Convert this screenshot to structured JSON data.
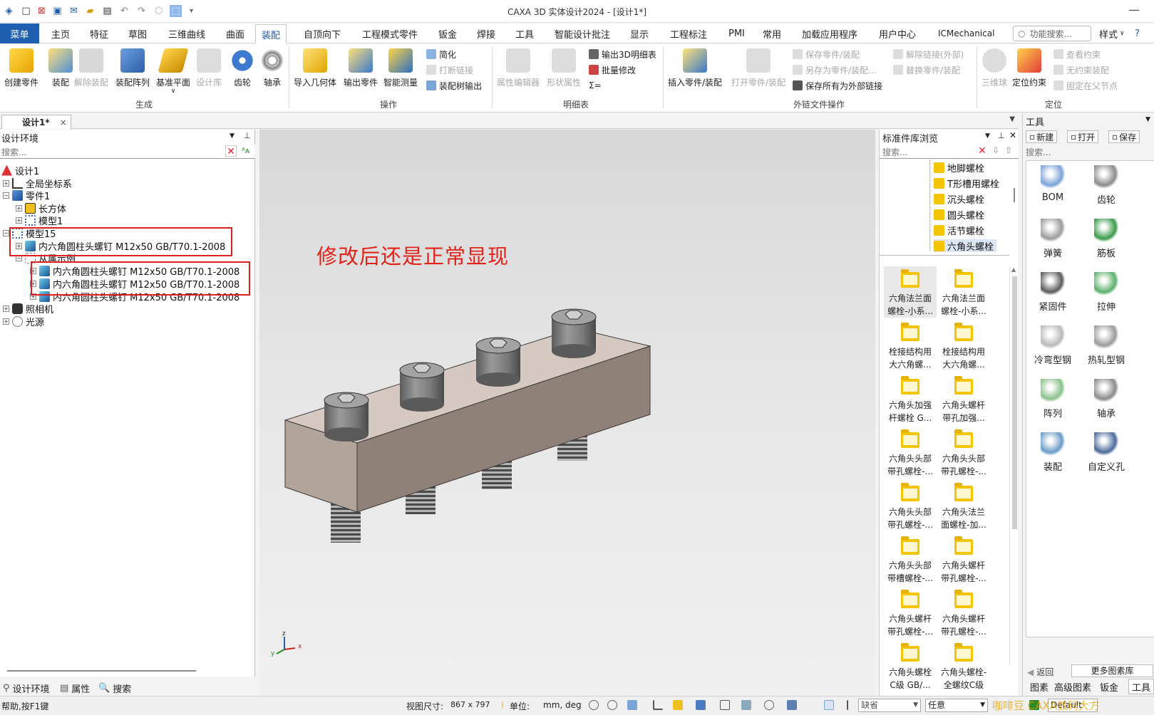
{
  "app": {
    "title": "CAXA 3D 实体设计2024 - [设计1*]"
  },
  "menu": {
    "menu_button": "菜单",
    "tabs": [
      "主页",
      "特征",
      "草图",
      "三维曲线",
      "曲面",
      "装配",
      "自顶向下",
      "工程模式零件",
      "钣金",
      "焊接",
      "工具",
      "智能设计批注",
      "显示",
      "工程标注",
      "PMI",
      "常用",
      "加载应用程序",
      "用户中心",
      "ICMechanical"
    ],
    "active_tab": "装配",
    "search_placeholder": "功能搜索...",
    "style_label": "样式"
  },
  "ribbon": {
    "groups": [
      {
        "label": "生成",
        "big": [
          "创建零件",
          "装配",
          "解除装配",
          "装配阵列",
          "基准平面",
          "设计库",
          "齿轮",
          "轴承"
        ]
      },
      {
        "label": "操作",
        "big": [
          "导入几何体",
          "输出零件",
          "智能测量"
        ],
        "small": [
          "简化",
          "打断链接",
          "装配树输出"
        ]
      },
      {
        "label": "明细表",
        "big": [
          "属性编辑器",
          "形状属性"
        ],
        "small": [
          "输出3D明细表",
          "批量修改",
          "Σ="
        ]
      },
      {
        "label": "外链文件操作",
        "big": [
          "插入零件/装配",
          "打开零件/装配"
        ],
        "small": [
          "保存零件/装配",
          "另存为零件/装配...",
          "保存所有为外部链接",
          "解除链接(外部)",
          "替换零件/装配"
        ]
      },
      {
        "label": "定位",
        "big": [
          "三维球",
          "定位约束"
        ],
        "small": [
          "查看约束",
          "无约束装配",
          "固定在父节点"
        ]
      }
    ]
  },
  "doc_tab": {
    "label": "设计1*",
    "close": "×"
  },
  "left_panel": {
    "title": "设计环境",
    "search_placeholder": "搜索...",
    "tree": [
      {
        "label": "设计1"
      },
      {
        "label": "全局坐标系"
      },
      {
        "label": "零件1"
      },
      {
        "label": "长方体"
      },
      {
        "label": "模型1"
      },
      {
        "label": "模型15"
      },
      {
        "label": "内六角圆柱头螺钉 M12x50 GB/T70.1-2008"
      },
      {
        "label": "从属示例"
      },
      {
        "label": "内六角圆柱头螺钉 M12x50 GB/T70.1-2008"
      },
      {
        "label": "内六角圆柱头螺钉 M12x50 GB/T70.1-2008"
      },
      {
        "label": "内六角圆柱头螺钉 M12x50 GB/T70.1-2008"
      },
      {
        "label": "照相机"
      },
      {
        "label": "光源"
      }
    ],
    "bottom_tabs": [
      "设计环境",
      "属性",
      "搜索"
    ]
  },
  "viewport": {
    "annotation": "修改后还是正常显现",
    "axis_labels": {
      "x": "x",
      "y": "y",
      "z": "z"
    }
  },
  "std_panel": {
    "title": "标准件库浏览",
    "search_placeholder": "搜索...",
    "folders": [
      "地脚螺栓",
      "T形槽用螺栓",
      "沉头螺栓",
      "圆头螺栓",
      "活节螺栓",
      "六角头螺栓"
    ],
    "items": [
      [
        "六角法兰面",
        "螺栓-小系..."
      ],
      [
        "六角法兰面",
        "螺栓-小系..."
      ],
      [
        "栓接结构用",
        "大六角螺..."
      ],
      [
        "栓接结构用",
        "大六角螺..."
      ],
      [
        "六角头加强",
        "杆螺栓 G..."
      ],
      [
        "六角头螺杆",
        "带孔加强..."
      ],
      [
        "六角头头部",
        "带孔螺栓-..."
      ],
      [
        "六角头头部",
        "带孔螺栓-..."
      ],
      [
        "六角头头部",
        "带孔螺栓-..."
      ],
      [
        "六角头法兰",
        "面螺栓-加..."
      ],
      [
        "六角头头部",
        "带槽螺栓-..."
      ],
      [
        "六角头螺杆",
        "带孔螺栓-..."
      ],
      [
        "六角头螺杆",
        "带孔螺栓-..."
      ],
      [
        "六角头螺杆",
        "带孔螺栓-..."
      ],
      [
        "六角头螺栓",
        "C级 GB/..."
      ],
      [
        "六角头螺栓-",
        "全螺纹C级"
      ]
    ]
  },
  "tool_panel": {
    "title": "工具",
    "buttons": [
      "新建",
      "打开",
      "保存"
    ],
    "search_placeholder": "搜索...",
    "items": [
      "BOM",
      "齿轮",
      "弹簧",
      "筋板",
      "紧固件",
      "拉伸",
      "冷弯型钢",
      "热轧型钢",
      "阵列",
      "轴承",
      "装配",
      "自定义孔"
    ],
    "back": "返回",
    "more": "更多图素库",
    "bottom_tabs": [
      "图素",
      "高级图素",
      "钣金",
      "工具"
    ]
  },
  "status": {
    "help": "帮助,按F1键",
    "view_size_label": "视图尺寸:",
    "view_size": "867 x  797",
    "unit_label": "单位:",
    "unit": "mm, deg",
    "filter": "缺省",
    "any": "任意",
    "default": "Default",
    "watermark": "咖啡豆 CAXA数码大方"
  },
  "colors": {
    "accent": "#1f5fb0",
    "annotation": "#e2231a",
    "highlight_box": "#e02020",
    "folder": "#f5c400"
  }
}
